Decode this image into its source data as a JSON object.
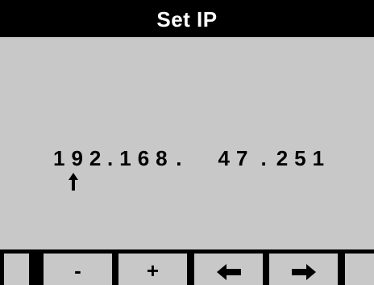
{
  "header": {
    "title": "Set IP"
  },
  "ip": {
    "octet1": "192",
    "octet2": "168",
    "octet3": "47",
    "octet4": "251",
    "separator": ".",
    "cursor_icon": "up-arrow-icon",
    "cursor_position": 0
  },
  "softkeys": {
    "decrement_label": "-",
    "increment_label": "+",
    "left_icon": "left-arrow-icon",
    "right_icon": "right-arrow-icon"
  },
  "colors": {
    "background": "#c8c8c8",
    "title_bar": "#000000",
    "title_text": "#ffffff",
    "text": "#000000"
  }
}
